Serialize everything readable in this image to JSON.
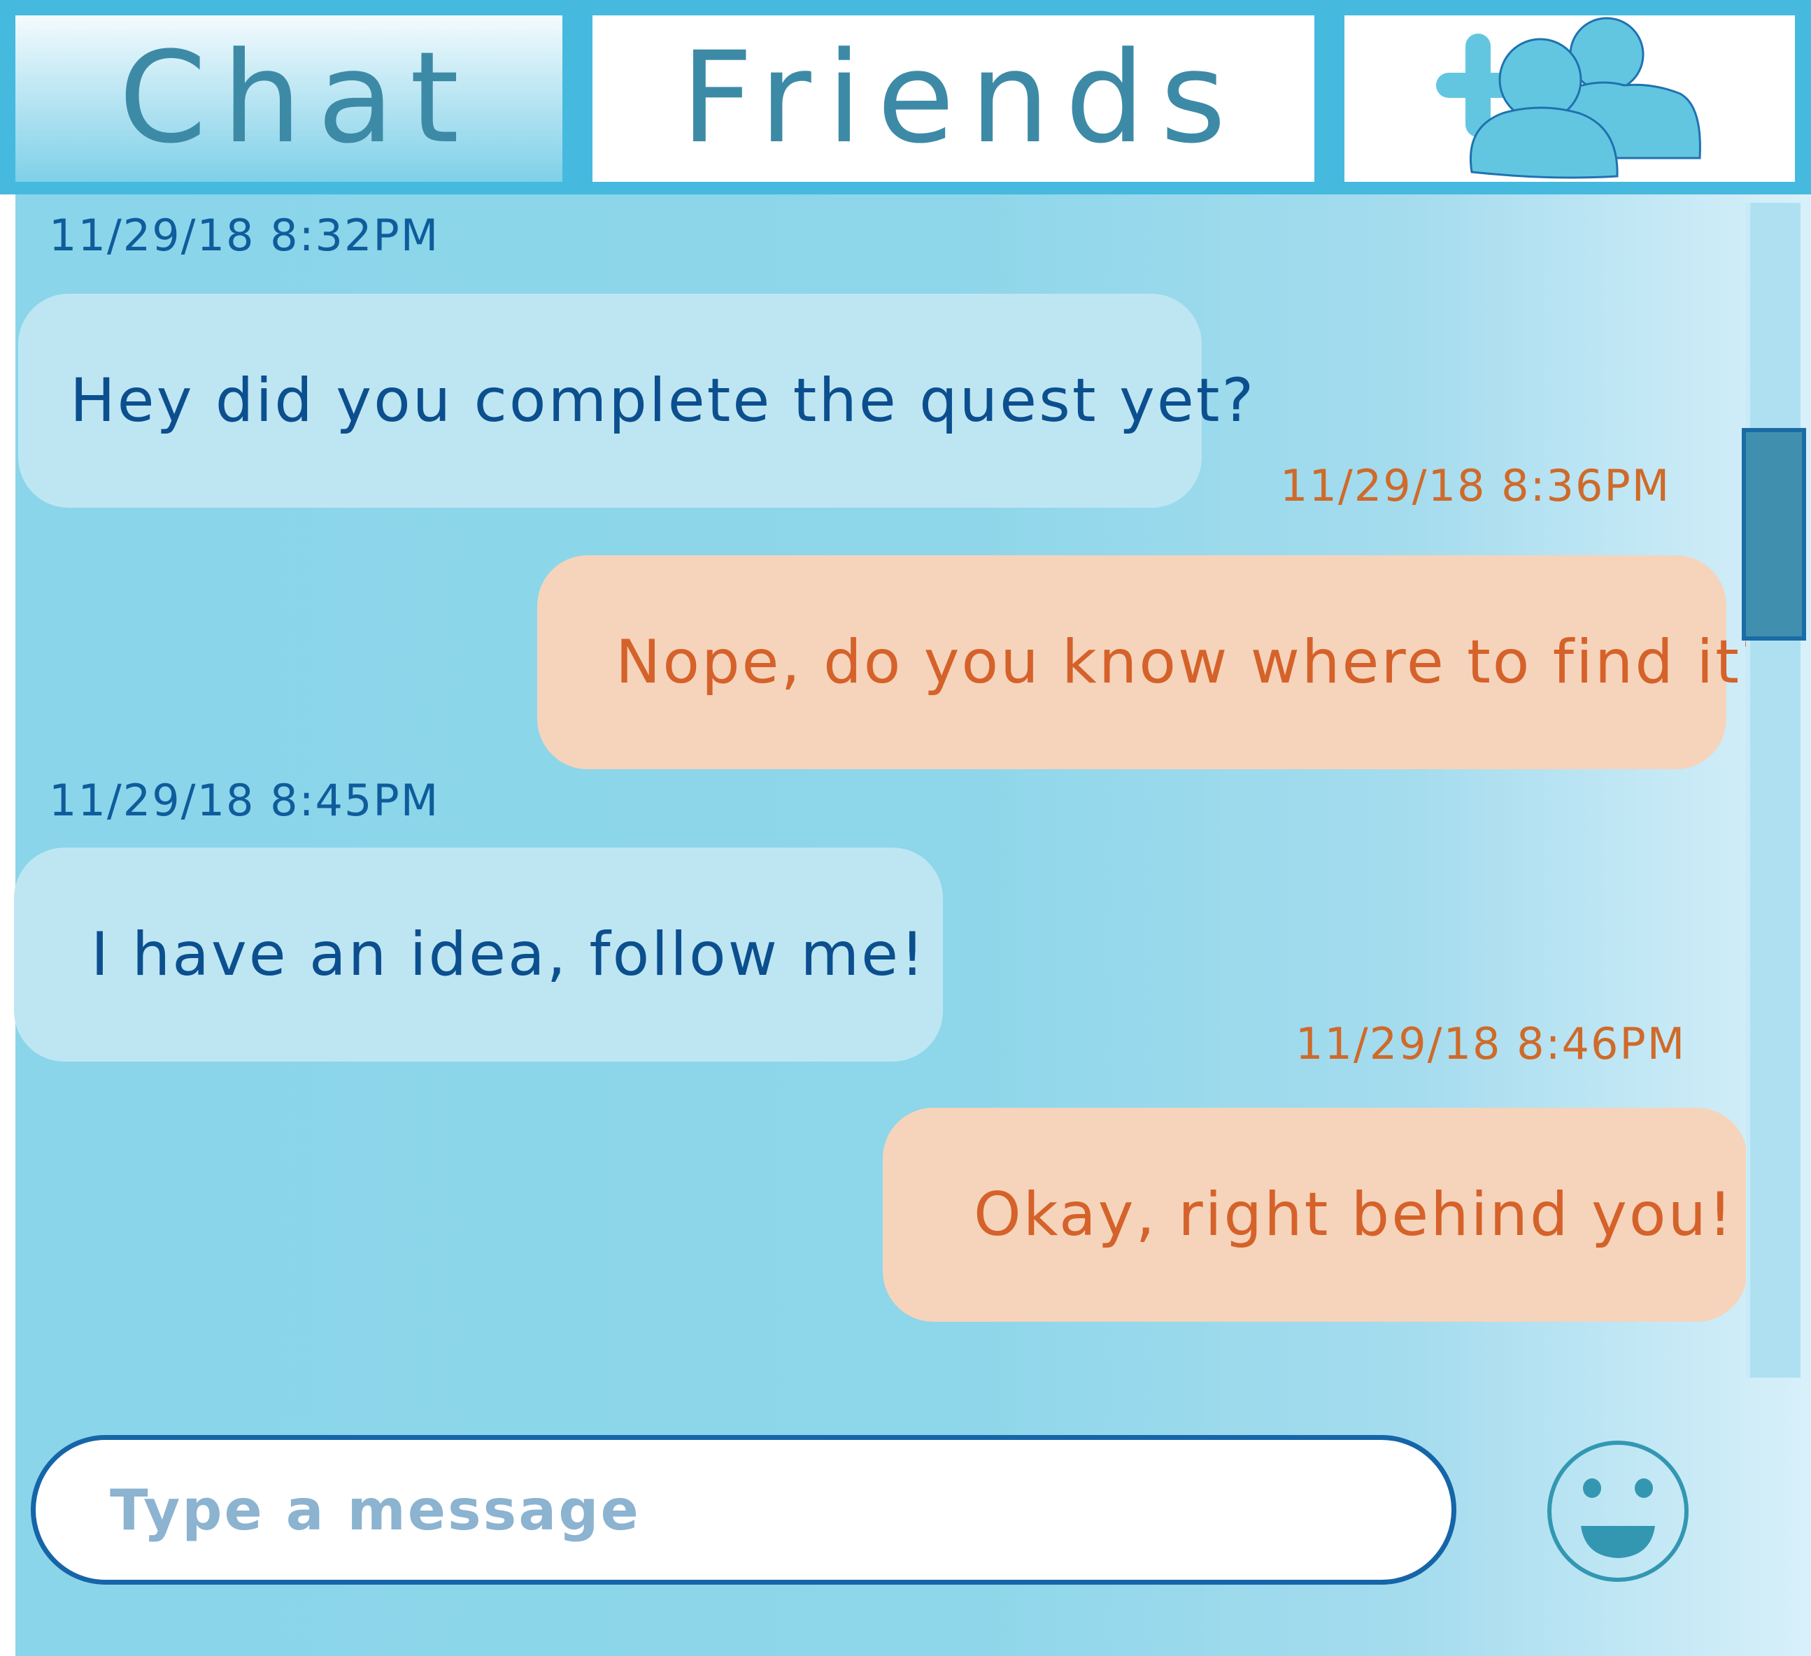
{
  "tabs": {
    "chat": "Chat",
    "friends": "Friends",
    "add_friend_icon": "add-friend-icon"
  },
  "messages": [
    {
      "direction": "incoming",
      "timestamp": "11/29/18 8:32PM",
      "text": "Hey did you complete the quest yet?"
    },
    {
      "direction": "outgoing",
      "timestamp": "11/29/18 8:36PM",
      "text": "Nope, do you know where to find it?"
    },
    {
      "direction": "incoming",
      "timestamp": "11/29/18 8:45PM",
      "text": "I have an idea, follow me!"
    },
    {
      "direction": "outgoing",
      "timestamp": "11/29/18 8:46PM",
      "text": "Okay, right behind you!"
    }
  ],
  "composer": {
    "placeholder": "Type a message",
    "emoji_icon": "smiley-icon"
  },
  "colors": {
    "frame": "#45bade",
    "tab_text": "#3d8aa7",
    "incoming_text": "#0c4f8f",
    "outgoing_text": "#d5622a",
    "incoming_bubble": "#bee6f2",
    "outgoing_bubble": "#f5d4bb"
  }
}
